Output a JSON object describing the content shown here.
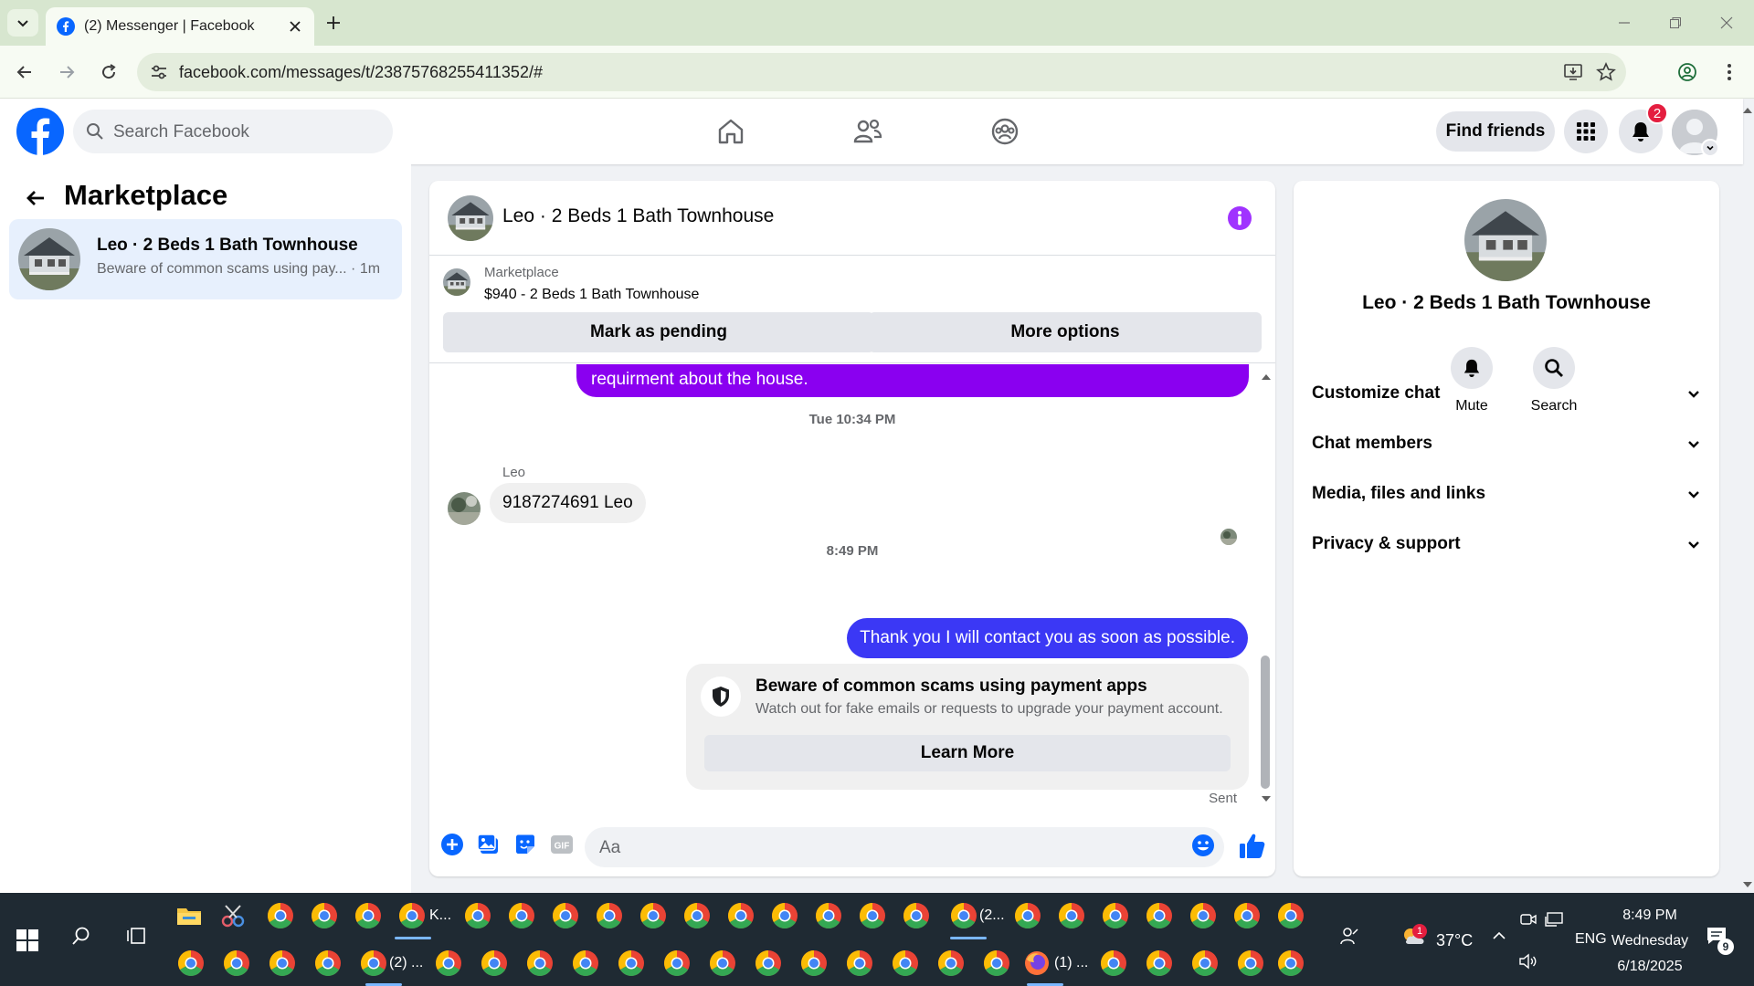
{
  "browser": {
    "tab_title": "(2) Messenger | Facebook",
    "url": "facebook.com/messages/t/23875768255411352/#"
  },
  "header": {
    "search_placeholder": "Search Facebook",
    "find_friends": "Find friends",
    "notification_count": "2"
  },
  "sidebar": {
    "title": "Marketplace",
    "conversation": {
      "name": "Leo · 2 Beds 1 Bath Townhouse",
      "preview": "Beware of common scams using pay...",
      "time": "· 1m"
    }
  },
  "chat": {
    "title": "Leo · 2 Beds 1 Bath Townhouse",
    "listing_label": "Marketplace",
    "listing_price": "$940 - 2 Beds 1 Bath Townhouse",
    "mark_pending": "Mark as pending",
    "more_options": "More options",
    "messages": {
      "prev_outgoing": "requirment about the house.",
      "timestamp_1": "Tue 10:34 PM",
      "sender": "Leo",
      "incoming": "9187274691  Leo",
      "timestamp_2": "8:49 PM",
      "outgoing": "Thank you I will contact  you as soon as possible.",
      "scam_title": "Beware of common scams using payment apps",
      "scam_body": "Watch out for fake emails or requests to upgrade your payment account.",
      "learn_more": "Learn More",
      "status": "Sent"
    },
    "composer_placeholder": "Aa"
  },
  "info_panel": {
    "name": "Leo · 2 Beds 1 Bath Townhouse",
    "mute": "Mute",
    "search": "Search",
    "sections": [
      "Customize chat",
      "Chat members",
      "Media, files and links",
      "Privacy & support"
    ]
  },
  "taskbar": {
    "app_label_k": "K...",
    "app_label_chrome_a": "(2...",
    "app_label_chrome_b": "(2) ...",
    "app_label_firefox": "(1) ...",
    "weather": "37°C",
    "weather_badge": "1",
    "language": "ENG",
    "time": "8:49 PM",
    "day": "Wednesday",
    "date": "6/18/2025",
    "notification_count": "9"
  },
  "colors": {
    "fb_blue": "#0866ff",
    "purple_bubble": "#8a00f0",
    "blue_bubble": "#3b38f5",
    "selected_item": "#e7f0fd",
    "info_purple": "#a033ff"
  }
}
